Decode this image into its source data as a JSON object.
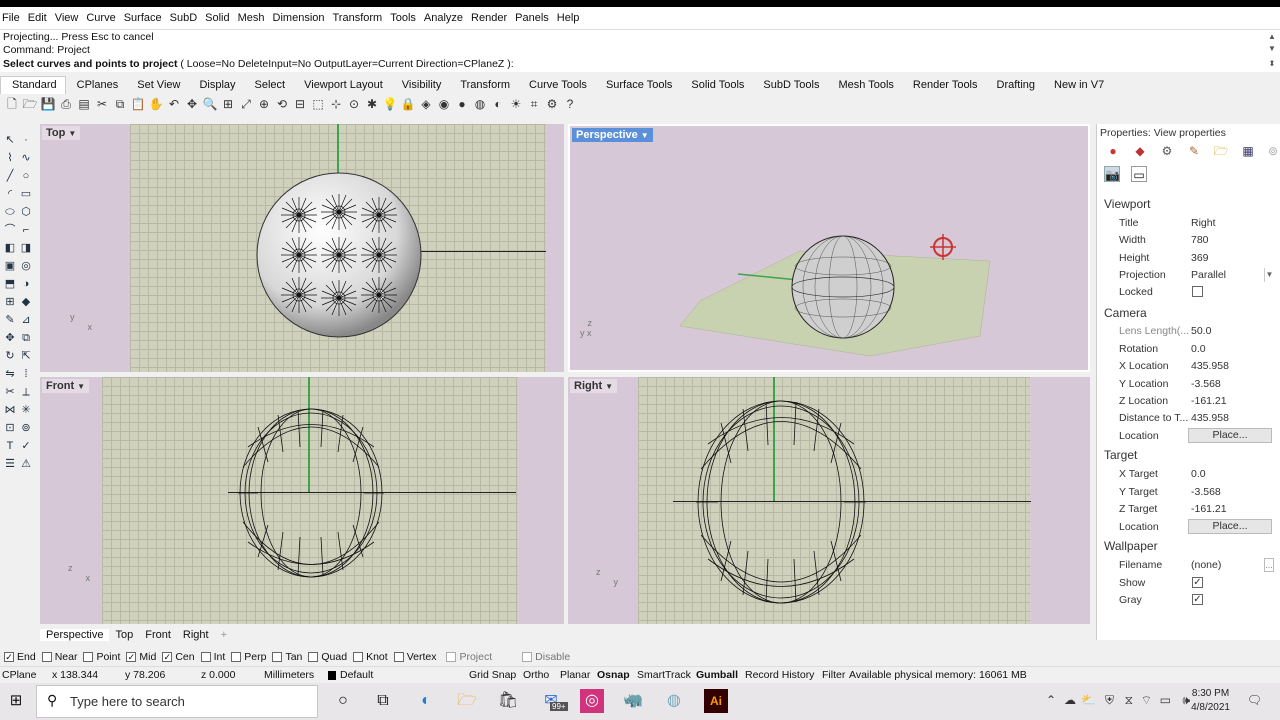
{
  "menu": [
    "File",
    "Edit",
    "View",
    "Curve",
    "Surface",
    "SubD",
    "Solid",
    "Mesh",
    "Dimension",
    "Transform",
    "Tools",
    "Analyze",
    "Render",
    "Panels",
    "Help"
  ],
  "command": {
    "history1": "Projecting... Press Esc to cancel",
    "history2": "Command: Project",
    "prompt_main": "Select curves and points to project",
    "prompt_options": "( Loose=No  DeleteInput=No  OutputLayer=Current  Direction=CPlaneZ ):"
  },
  "toolbar_tabs": [
    "Standard",
    "CPlanes",
    "Set View",
    "Display",
    "Select",
    "Viewport Layout",
    "Visibility",
    "Transform",
    "Curve Tools",
    "Surface Tools",
    "Solid Tools",
    "SubD Tools",
    "Mesh Tools",
    "Render Tools",
    "Drafting",
    "New in V7"
  ],
  "viewports": {
    "top": "Top",
    "perspective": "Perspective",
    "front": "Front",
    "right": "Right"
  },
  "viewport_tabs": [
    "Perspective",
    "Top",
    "Front",
    "Right"
  ],
  "properties": {
    "title": "Properties: View properties",
    "viewport_section": "Viewport",
    "title_label": "Title",
    "title_value": "Right",
    "width_label": "Width",
    "width_value": "780",
    "height_label": "Height",
    "height_value": "369",
    "projection_label": "Projection",
    "projection_value": "Parallel",
    "locked_label": "Locked",
    "camera_section": "Camera",
    "lens_label": "Lens Length(...",
    "lens_value": "50.0",
    "rotation_label": "Rotation",
    "rotation_value": "0.0",
    "xloc_label": "X Location",
    "xloc_value": "435.958",
    "yloc_label": "Y Location",
    "yloc_value": "-3.568",
    "zloc_label": "Z Location",
    "zloc_value": "-161.21",
    "dist_label": "Distance to T...",
    "dist_value": "435.958",
    "cam_location_label": "Location",
    "place_btn": "Place...",
    "target_section": "Target",
    "xt_label": "X Target",
    "xt_value": "0.0",
    "yt_label": "Y Target",
    "yt_value": "-3.568",
    "zt_label": "Z Target",
    "zt_value": "-161.21",
    "tgt_location_label": "Location",
    "wallpaper_section": "Wallpaper",
    "filename_label": "Filename",
    "filename_value": "(none)",
    "show_label": "Show",
    "gray_label": "Gray"
  },
  "osnaps": [
    {
      "label": "End",
      "checked": true
    },
    {
      "label": "Near",
      "checked": false
    },
    {
      "label": "Point",
      "checked": false
    },
    {
      "label": "Mid",
      "checked": true
    },
    {
      "label": "Cen",
      "checked": true
    },
    {
      "label": "Int",
      "checked": false
    },
    {
      "label": "Perp",
      "checked": false
    },
    {
      "label": "Tan",
      "checked": false
    },
    {
      "label": "Quad",
      "checked": false
    },
    {
      "label": "Knot",
      "checked": false
    },
    {
      "label": "Vertex",
      "checked": false
    },
    {
      "label": "Project",
      "checked": false
    },
    {
      "label": "Disable",
      "checked": false
    }
  ],
  "status": {
    "cplane": "CPlane",
    "x": "x 138.344",
    "y": "y 78.206",
    "z": "z 0.000",
    "units": "Millimeters",
    "layer": "Default",
    "grid_snap": "Grid Snap",
    "ortho": "Ortho",
    "planar": "Planar",
    "osnap": "Osnap",
    "smarttrack": "SmartTrack",
    "gumball": "Gumball",
    "record_history": "Record History",
    "filter": "Filter",
    "memory": "Available physical memory: 16061 MB"
  },
  "taskbar": {
    "search_placeholder": "Type here to search",
    "time": "8:30 PM",
    "date": "4/8/2021",
    "badge": "99+"
  }
}
